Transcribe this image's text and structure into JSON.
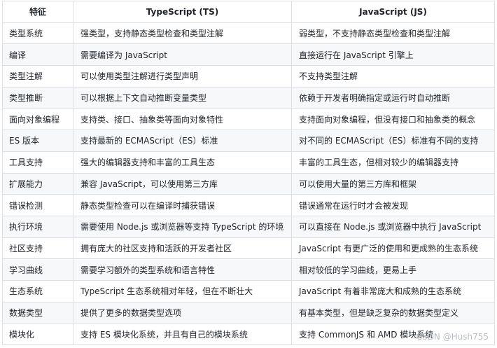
{
  "table": {
    "headers": [
      "特征",
      "TypeScript (TS)",
      "JavaScript (JS)"
    ],
    "rows": [
      [
        "类型系统",
        "强类型，支持静态类型检查和类型注解",
        "弱类型，不支持静态类型检查和类型注解"
      ],
      [
        "编译",
        "需要编译为 JavaScript",
        "直接运行在 JavaScript 引擎上"
      ],
      [
        "类型注解",
        "可以使用类型注解进行类型声明",
        "不支持类型注解"
      ],
      [
        "类型推断",
        "可以根据上下文自动推断变量类型",
        "依赖于开发者明确指定或运行时自动推断"
      ],
      [
        "面向对象编程",
        "支持类、接口、抽象类等面向对象特性",
        "支持面向对象编程，但没有接口和抽象类的概念"
      ],
      [
        "ES 版本",
        "支持最新的 ECMAScript（ES）标准",
        "对不同的 ECMAScript（ES）标准有不同的支持"
      ],
      [
        "工具支持",
        "强大的编辑器支持和丰富的工具生态",
        "丰富的工具生态，但相对较少的编辑器支持"
      ],
      [
        "扩展能力",
        "兼容 JavaScript，可以使用第三方库",
        "可以使用大量的第三方库和框架"
      ],
      [
        "错误检测",
        "静态类型检查可以在编译时捕获错误",
        "错误通常在运行时才会被发现"
      ],
      [
        "执行环境",
        "需要使用 Node.js 或浏览器等支持 TypeScript 的环境",
        "可以直接在 Node.js 或浏览器中执行 JavaScript"
      ],
      [
        "社区支持",
        "拥有庞大的社区支持和活跃的开发者社区",
        "JavaScript 有更广泛的使用和更成熟的生态系统"
      ],
      [
        "学习曲线",
        "需要学习额外的类型系统和语言特性",
        "相对较低的学习曲线，更易上手"
      ],
      [
        "生态系统",
        "TypeScript 生态系统相对年轻，但在不断壮大",
        "JavaScript 有着非常庞大和成熟的生态系统"
      ],
      [
        "数据类型",
        "提供了更多的数据类型选项",
        "有基本类型，但是缺乏复杂的数据类型定义"
      ],
      [
        "模块化",
        "支持 ES 模块化系统，并且有自己的模块系统",
        "支持 CommonJS 和 AMD 模块系统"
      ]
    ]
  },
  "watermark": "CSDN @Hush755"
}
